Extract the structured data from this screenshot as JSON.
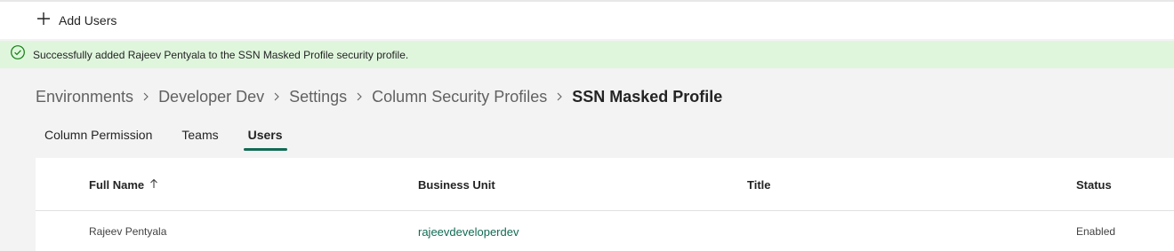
{
  "command_bar": {
    "add_users_label": "Add Users",
    "add_icon": "plus-icon"
  },
  "notification": {
    "icon": "checkmark-circle-icon",
    "message": "Successfully added Rajeev Pentyala to the SSN Masked Profile security profile.",
    "color": "#dff6dd"
  },
  "breadcrumb": {
    "items": [
      "Environments",
      "Developer Dev",
      "Settings",
      "Column Security Profiles"
    ],
    "current": "SSN Masked Profile",
    "separator_icon": "chevron-right-icon"
  },
  "tabs": [
    {
      "label": "Column Permission",
      "active": false
    },
    {
      "label": "Teams",
      "active": false
    },
    {
      "label": "Users",
      "active": true
    }
  ],
  "grid": {
    "columns": [
      {
        "label": "Full Name",
        "sort": "ascending",
        "sort_icon": "arrow-up-icon"
      },
      {
        "label": "Business Unit"
      },
      {
        "label": "Title"
      },
      {
        "label": "Status"
      }
    ],
    "rows": [
      {
        "full_name": "Rajeev Pentyala",
        "business_unit": "rajeevdeveloperdev",
        "title": "",
        "status": "Enabled"
      }
    ]
  },
  "colors": {
    "accent": "#116b54",
    "success_bg": "#dff6dd",
    "success_icon": "#107c10"
  }
}
